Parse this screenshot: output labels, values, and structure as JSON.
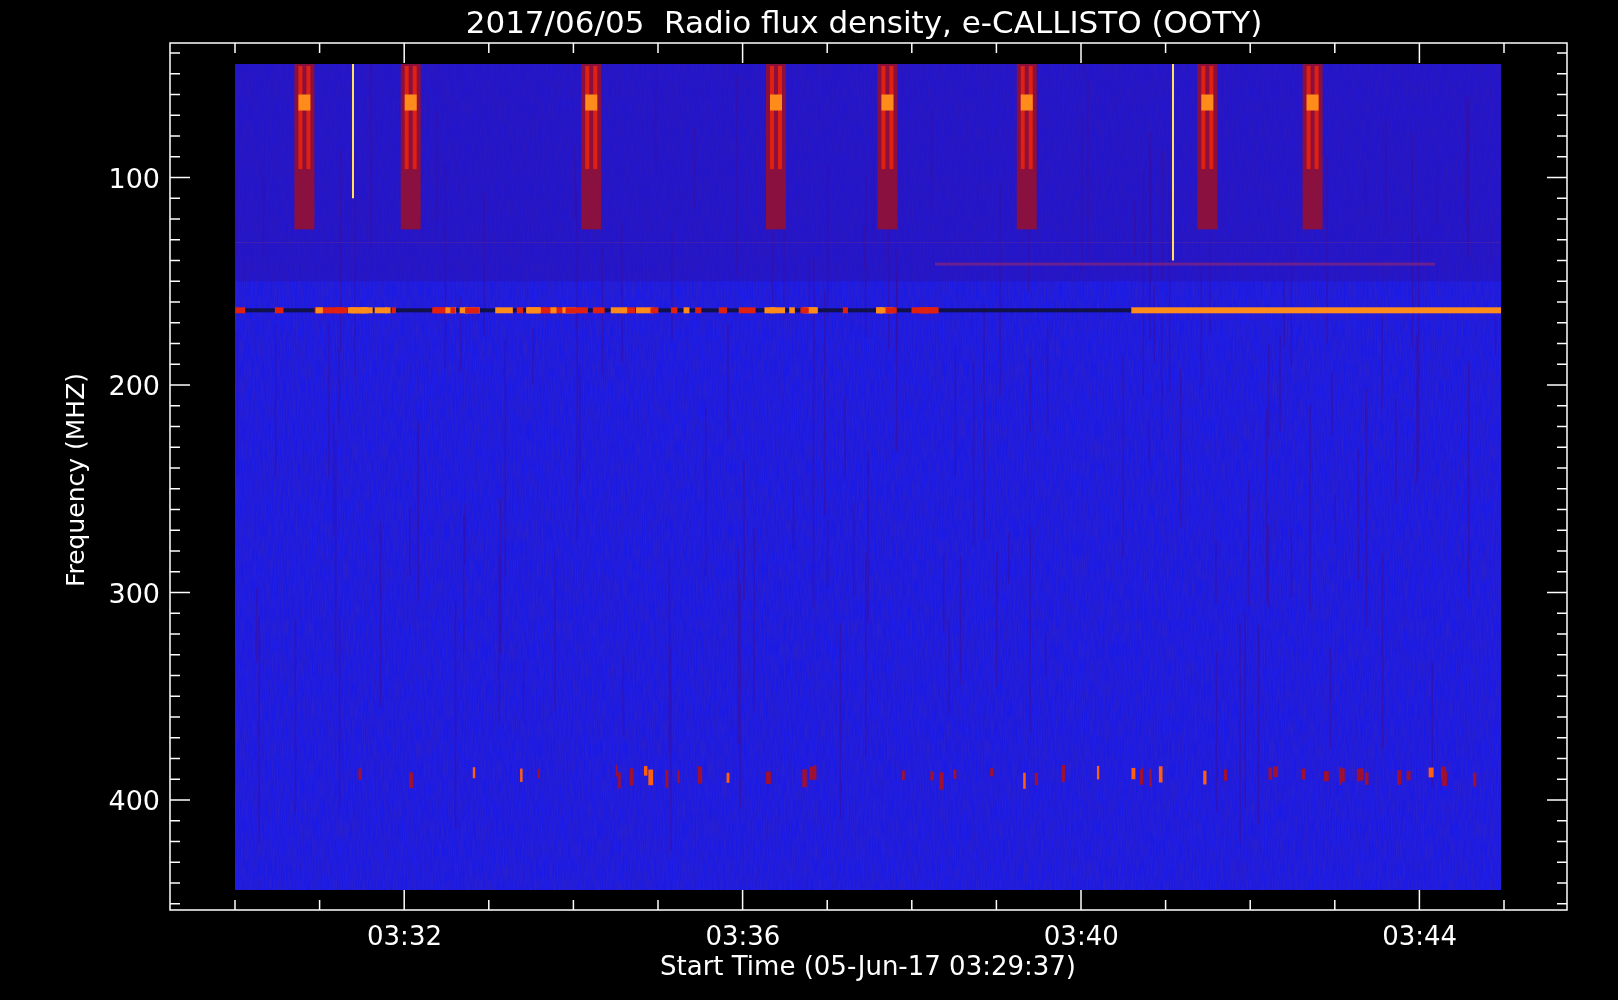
{
  "title": "2017/06/05  Radio flux density, e-CALLISTO (OOTY)",
  "y_axis": {
    "label": "Frequency (MHZ)",
    "ticks": [
      "100",
      "200",
      "300",
      "400"
    ]
  },
  "x_axis": {
    "label": "Start Time (05-Jun-17 03:29:37)",
    "ticks": [
      "03:32",
      "03:36",
      "03:40",
      "03:44"
    ]
  }
}
